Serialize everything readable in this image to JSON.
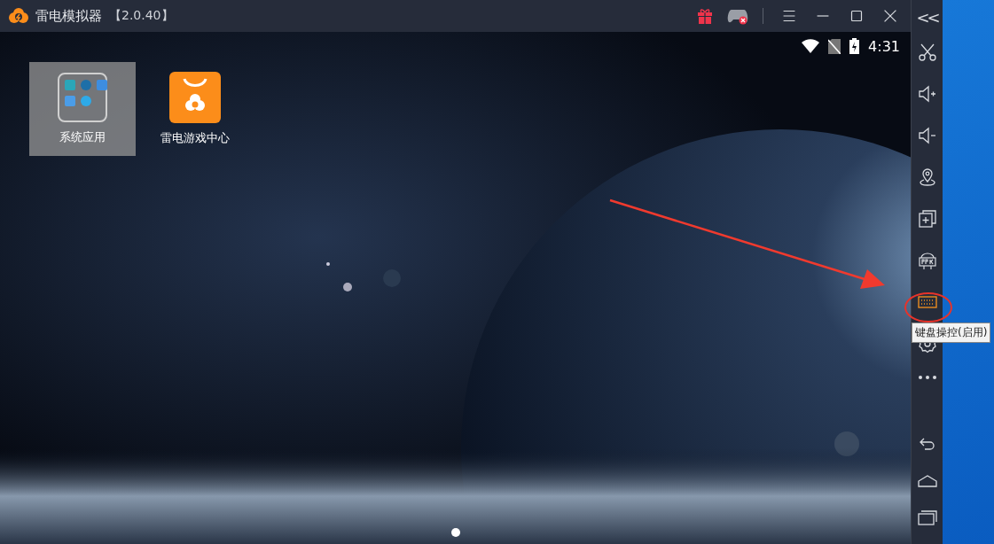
{
  "window": {
    "title": "雷电模拟器",
    "version": "【2.0.40】"
  },
  "title_bar_buttons": [
    {
      "kind": "gift"
    },
    {
      "kind": "gamepad"
    },
    {
      "kind": "menu"
    },
    {
      "kind": "minimize"
    },
    {
      "kind": "maximize"
    },
    {
      "kind": "close"
    }
  ],
  "status_bar": {
    "time": "4:31"
  },
  "desktop_icons": [
    {
      "label": "系统应用",
      "kind": "folder",
      "selected": true
    },
    {
      "label": "雷电游戏中心",
      "kind": "store",
      "selected": false
    }
  ],
  "page_dots": [
    {
      "selected": true
    }
  ],
  "sidebar": {
    "collapse": "<<",
    "tools": [
      {
        "kind": "scissors",
        "active": false
      },
      {
        "kind": "volume-up",
        "active": false
      },
      {
        "kind": "volume-down",
        "active": false
      },
      {
        "kind": "location",
        "active": false
      },
      {
        "kind": "multi-window",
        "active": false
      },
      {
        "kind": "apk",
        "active": false
      },
      {
        "kind": "keyboard",
        "active": true
      },
      {
        "kind": "settings",
        "active": false
      },
      {
        "kind": "more",
        "active": false
      }
    ],
    "nav": [
      {
        "kind": "back"
      },
      {
        "kind": "home"
      },
      {
        "kind": "recents"
      }
    ]
  },
  "tooltip": "键盘操控(启用)"
}
